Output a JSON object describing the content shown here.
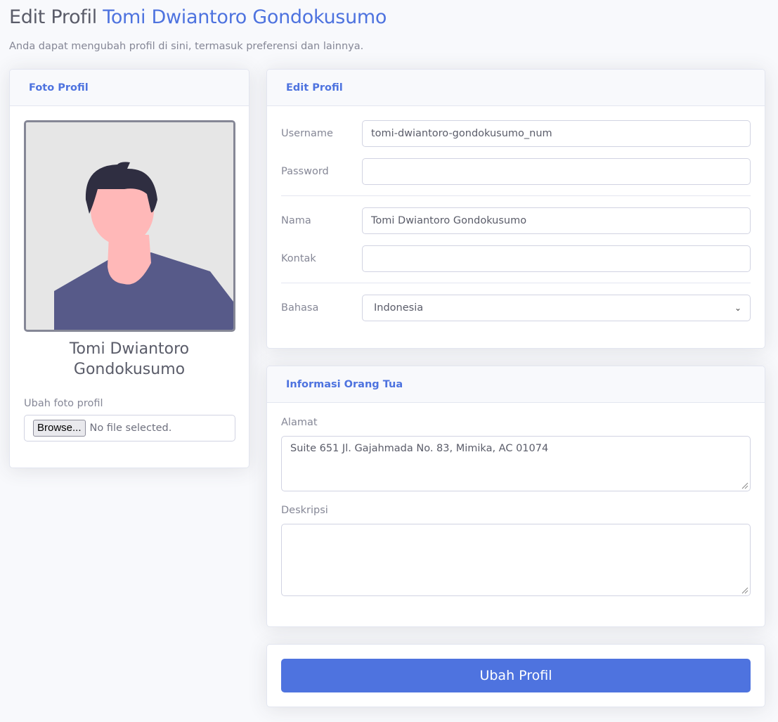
{
  "header": {
    "title_prefix": "Edit Profil",
    "title_name": "Tomi Dwiantoro Gondokusumo",
    "subtitle": "Anda dapat mengubah profil di sini, termasuk preferensi dan lainnya."
  },
  "photo_card": {
    "title": "Foto Profil",
    "name_line1": "Tomi Dwiantoro",
    "name_line2": "Gondokusumo",
    "upload_label": "Ubah foto profil",
    "browse_label": "Browse...",
    "file_status": "No file selected."
  },
  "edit_card": {
    "title": "Edit Profil",
    "username_label": "Username",
    "username_value": "tomi-dwiantoro-gondokusumo_num",
    "password_label": "Password",
    "password_value": "",
    "nama_label": "Nama",
    "nama_value": "Tomi Dwiantoro Gondokusumo",
    "kontak_label": "Kontak",
    "kontak_value": "",
    "bahasa_label": "Bahasa",
    "bahasa_value": "Indonesia"
  },
  "parent_card": {
    "title": "Informasi Orang Tua",
    "alamat_label": "Alamat",
    "alamat_value": "Suite 651 Jl. Gajahmada No. 83, Mimika, AC 01074",
    "deskripsi_label": "Deskripsi",
    "deskripsi_value": ""
  },
  "submit": {
    "label": "Ubah Profil"
  },
  "colors": {
    "primary": "#4e73df",
    "text": "#5a5c69",
    "muted": "#858796",
    "shirt": "#575a89",
    "hair": "#2f2e41",
    "skin": "#ffb8b8"
  }
}
